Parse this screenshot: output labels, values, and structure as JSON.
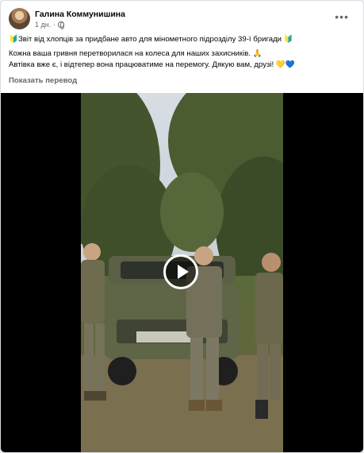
{
  "post": {
    "author": "Галина Коммунишина",
    "time": "1 дн.",
    "more_icon": "more-options-icon",
    "lines": [
      "🔰Звіт від хлопців за придбане авто для мінометного підрозділу 39-ї бригади 🔰",
      "Кожна ваша гривня перетворилася на колеса для наших захисників. 🙏",
      "Автівка вже є, і відтепер вона працюватиме на перемогу. Дякую вам, друзі! 💛💙"
    ],
    "see_translation": "Показать перевод"
  },
  "video": {
    "play_icon": "play-icon",
    "description_hidden": true
  },
  "colors": {
    "text": "#050505",
    "secondary": "#65676b",
    "background": "#ffffff"
  }
}
